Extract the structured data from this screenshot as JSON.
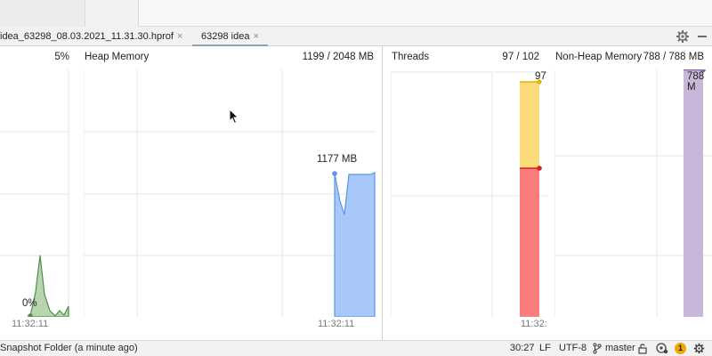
{
  "tabs": [
    {
      "label": "idea_63298_08.03.2021_11.31.30.hprof",
      "close": "×"
    },
    {
      "label": "63298 idea",
      "close": "×",
      "active": true
    }
  ],
  "toolbar_icons": [
    "gear-icon",
    "minimize-icon"
  ],
  "panels": {
    "cpu": {
      "value": "5%",
      "annotation": "0%",
      "tick": "11:32:11",
      "color": "#7cb56f"
    },
    "heap": {
      "title": "Heap Memory",
      "value": "1199 / 2048 MB",
      "annotation": "1177 MB",
      "tick": "11:32:11",
      "color": "#a7c8f8"
    },
    "threads": {
      "title": "Threads",
      "value": "97 / 102",
      "annotation": "97",
      "tick": "11:32:",
      "colors": [
        "#fcdc7a",
        "#fb7c7c"
      ]
    },
    "nonheap": {
      "title": "Non-Heap Memory",
      "value": "788 / 788 MB",
      "annotation": "788 M",
      "color": "#c9b7d9"
    }
  },
  "status": {
    "left": "Snapshot Folder (a minute ago)",
    "position": "30:27",
    "line_ending": "LF",
    "encoding": "UTF-8",
    "branch": "master",
    "notifications": "1"
  }
}
